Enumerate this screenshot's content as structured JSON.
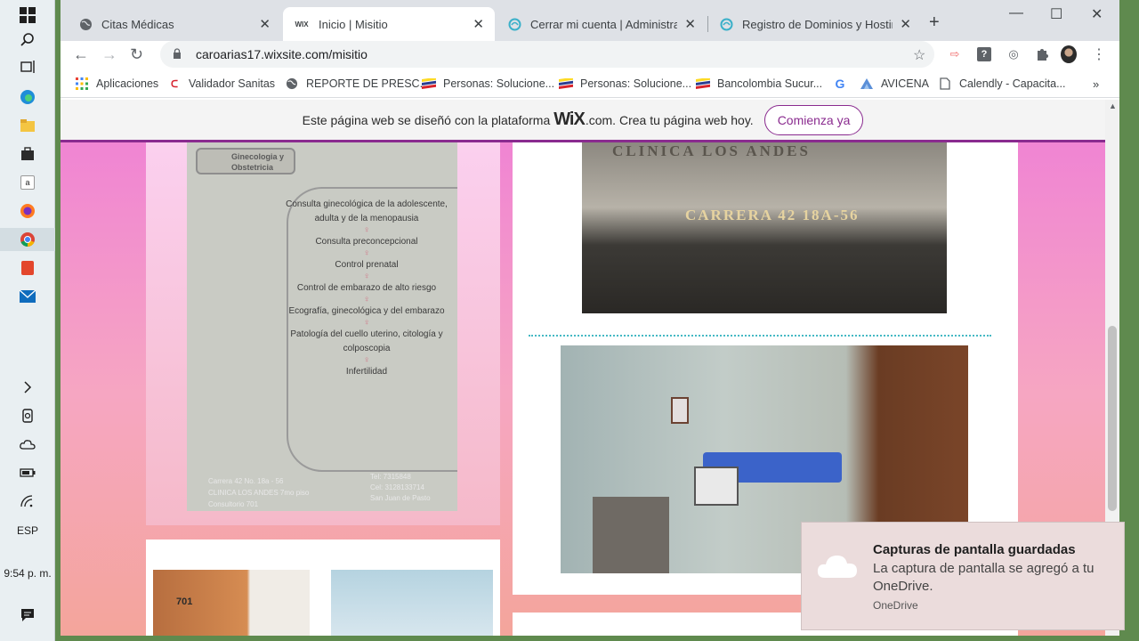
{
  "taskbar": {
    "language": "ESP",
    "clock": "9:54 p. m."
  },
  "tabs": [
    {
      "title": "Citas Médicas",
      "favicon": "globe-icon"
    },
    {
      "title": "Inicio | Misitio",
      "favicon": "WIX"
    },
    {
      "title": "Cerrar mi cuenta | Administración",
      "favicon": "hosting-icon"
    },
    {
      "title": "Registro de Dominios y Hosting e",
      "favicon": "hosting-icon"
    }
  ],
  "address_bar": {
    "url": "caroarias17.wixsite.com/misitio"
  },
  "bookmarks": [
    {
      "label": "Aplicaciones"
    },
    {
      "label": "Validador Sanitas"
    },
    {
      "label": "REPORTE DE PRESC..."
    },
    {
      "label": "Personas: Solucione..."
    },
    {
      "label": "Personas: Solucione..."
    },
    {
      "label": "Bancolombia Sucur..."
    },
    {
      "label": "G"
    },
    {
      "label": "AVICENA"
    },
    {
      "label": "Calendly - Capacita..."
    }
  ],
  "wix_banner": {
    "text_before": "Este página web se diseñó con la plataforma",
    "logo": "WiX",
    "text_after": ".com. Crea tu página web hoy.",
    "cta": "Comienza ya"
  },
  "flyer": {
    "header": "Ginecologia y Obstetricia",
    "services": [
      "Consulta ginecológica de la adolescente, adulta y de la menopausia",
      "Consulta preconcepcional",
      "Control prenatal",
      "Control de embarazo de alto riesgo",
      "Ecografía, ginecológica y del embarazo",
      "Patología del cuello uterino, citología y colposcopia",
      "Infertilidad"
    ],
    "address_lines": [
      "Carrera 42 No. 18a - 56",
      "CLINICA LOS ANDES 7mo piso",
      "Consultorio 701"
    ],
    "contact_lines": [
      "Tel: 7315848",
      "Cel: 3128133714",
      "San Juan de Pasto"
    ]
  },
  "building_photo": {
    "sign": "CLINICA LOS ANDES",
    "plate": "CARRERA 42 18A-56"
  },
  "door_photo": {
    "number": "701"
  },
  "toast": {
    "title": "Capturas de pantalla guardadas",
    "body": "La captura de pantalla se agregó a tu OneDrive.",
    "source": "OneDrive"
  },
  "colors": {
    "wix_accent": "#8a2b8f",
    "divider": "#45b9c4",
    "page_bg_top": "#ef7fd6",
    "page_bg_bottom": "#f4a59b"
  }
}
